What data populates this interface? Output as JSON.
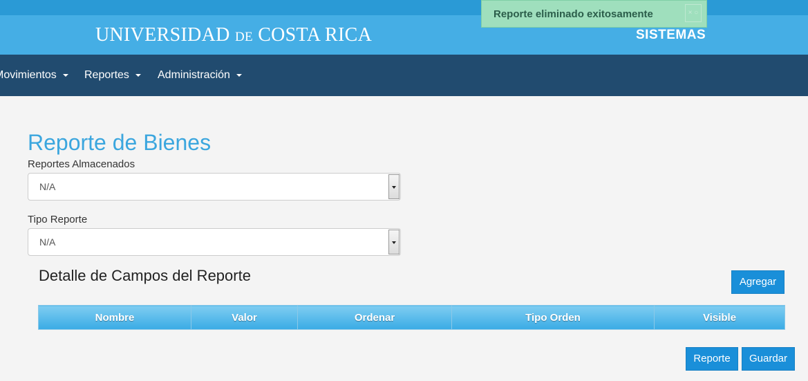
{
  "header": {
    "logo": {
      "part1": "UNIVERSIDAD",
      "part2": "DE",
      "part3": "COSTA RICA"
    },
    "subtitle": "SISTEMAS"
  },
  "toast": {
    "message": "Reporte eliminado exitosamente",
    "close_glyph": "× ○"
  },
  "nav": {
    "items": [
      {
        "label": "Movimientos"
      },
      {
        "label": "Reportes"
      },
      {
        "label": "Administración"
      }
    ]
  },
  "page": {
    "title": "Reporte de Bienes",
    "stored_reports": {
      "label": "Reportes Almacenados",
      "value": "N/A"
    },
    "report_type": {
      "label": "Tipo Reporte",
      "value": "N/A"
    },
    "details": {
      "title": "Detalle de Campos del Reporte",
      "add_label": "Agregar",
      "columns": [
        "Nombre",
        "Valor",
        "Ordenar",
        "Tipo Orden",
        "Visible"
      ]
    },
    "actions": {
      "report_label": "Reporte",
      "save_label": "Guardar"
    }
  },
  "colors": {
    "brand": "#45aee5",
    "navbar": "#214b6f",
    "title": "#3ba6de",
    "button": "#1a8fd9",
    "toast": "#9fdfbd"
  }
}
